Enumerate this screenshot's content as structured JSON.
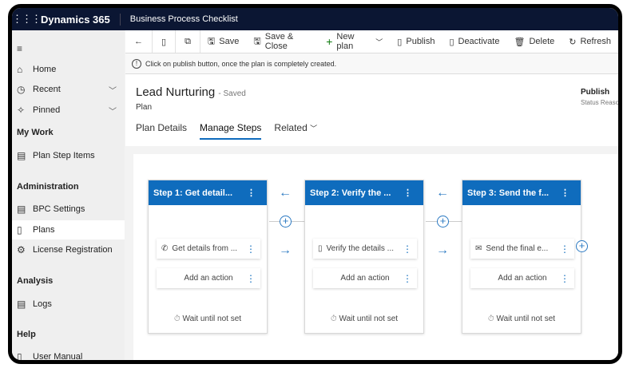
{
  "topbar": {
    "brand": "Dynamics 365",
    "app": "Business Process Checklist"
  },
  "sidebar": {
    "items": [
      {
        "label": "Home",
        "icon": "home-icon",
        "glyph": "⌂"
      },
      {
        "label": "Recent",
        "icon": "clock-icon",
        "glyph": "◷",
        "chev": "﹀"
      },
      {
        "label": "Pinned",
        "icon": "pin-icon",
        "glyph": "✧",
        "chev": "﹀"
      },
      {
        "label": "Plan Step Items",
        "icon": "list-icon",
        "glyph": "▤"
      },
      {
        "label": "BPC Settings",
        "icon": "list-icon",
        "glyph": "▤"
      },
      {
        "label": "Plans",
        "icon": "document-icon",
        "glyph": "▯"
      },
      {
        "label": "License Registration",
        "icon": "gear-icon",
        "glyph": "⚙"
      },
      {
        "label": "Logs",
        "icon": "log-icon",
        "glyph": "▤"
      },
      {
        "label": "User Manual",
        "icon": "book-icon",
        "glyph": "▯"
      }
    ],
    "sections": [
      "My Work",
      "Administration",
      "Analysis",
      "Help"
    ]
  },
  "toolbar": {
    "save": "Save",
    "save_close": "Save & Close",
    "new_plan": "New plan",
    "publish": "Publish",
    "deactivate": "Deactivate",
    "delete": "Delete",
    "refresh": "Refresh"
  },
  "notice": "Click on publish button, once the plan is completely created.",
  "header": {
    "title": "Lead Nurturing",
    "saved": "- Saved",
    "entity": "Plan",
    "status_value": "Publish",
    "status_label": "Status Reason"
  },
  "tabs": [
    "Plan Details",
    "Manage Steps",
    "Related"
  ],
  "steps": [
    {
      "title": "Step 1: Get detail...",
      "action": "Get details from ...",
      "action_icon": "phone-icon",
      "glyph": "✆",
      "add": "Add an action",
      "wait": "Wait until not set"
    },
    {
      "title": "Step 2: Verify the ...",
      "action": "Verify the details ...",
      "action_icon": "document-icon",
      "glyph": "▯",
      "add": "Add an action",
      "wait": "Wait until not set"
    },
    {
      "title": "Step 3: Send the f...",
      "action": "Send the final e...",
      "action_icon": "mail-icon",
      "glyph": "✉",
      "add": "Add an action",
      "wait": "Wait until not set"
    }
  ],
  "colors": {
    "topbar": "#0b1633",
    "accent": "#0f6cbd"
  }
}
